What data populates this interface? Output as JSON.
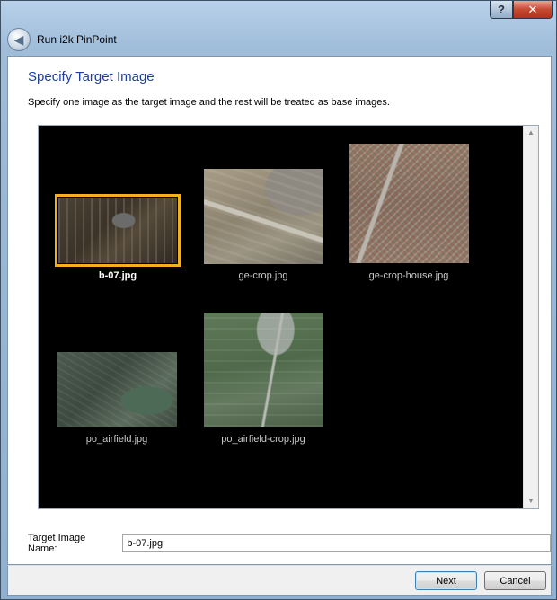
{
  "window": {
    "title": "Run i2k PinPoint",
    "help_glyph": "?",
    "close_glyph": "✕",
    "back_glyph": "◀"
  },
  "page": {
    "heading": "Specify Target Image",
    "description": "Specify one image as the target image and the rest will be treated as base images."
  },
  "images": [
    {
      "name": "b-07.jpg",
      "selected": true
    },
    {
      "name": "ge-crop.jpg",
      "selected": false
    },
    {
      "name": "ge-crop-house.jpg",
      "selected": false
    },
    {
      "name": "po_airfield.jpg",
      "selected": false
    },
    {
      "name": "po_airfield-crop.jpg",
      "selected": false
    }
  ],
  "target_field": {
    "label": "Target Image Name:",
    "value": "b-07.jpg"
  },
  "buttons": {
    "next": "Next",
    "cancel": "Cancel"
  },
  "colors": {
    "heading": "#1e3e9e",
    "selection_frame": "#f2b01e",
    "viewer_background": "#000000"
  }
}
